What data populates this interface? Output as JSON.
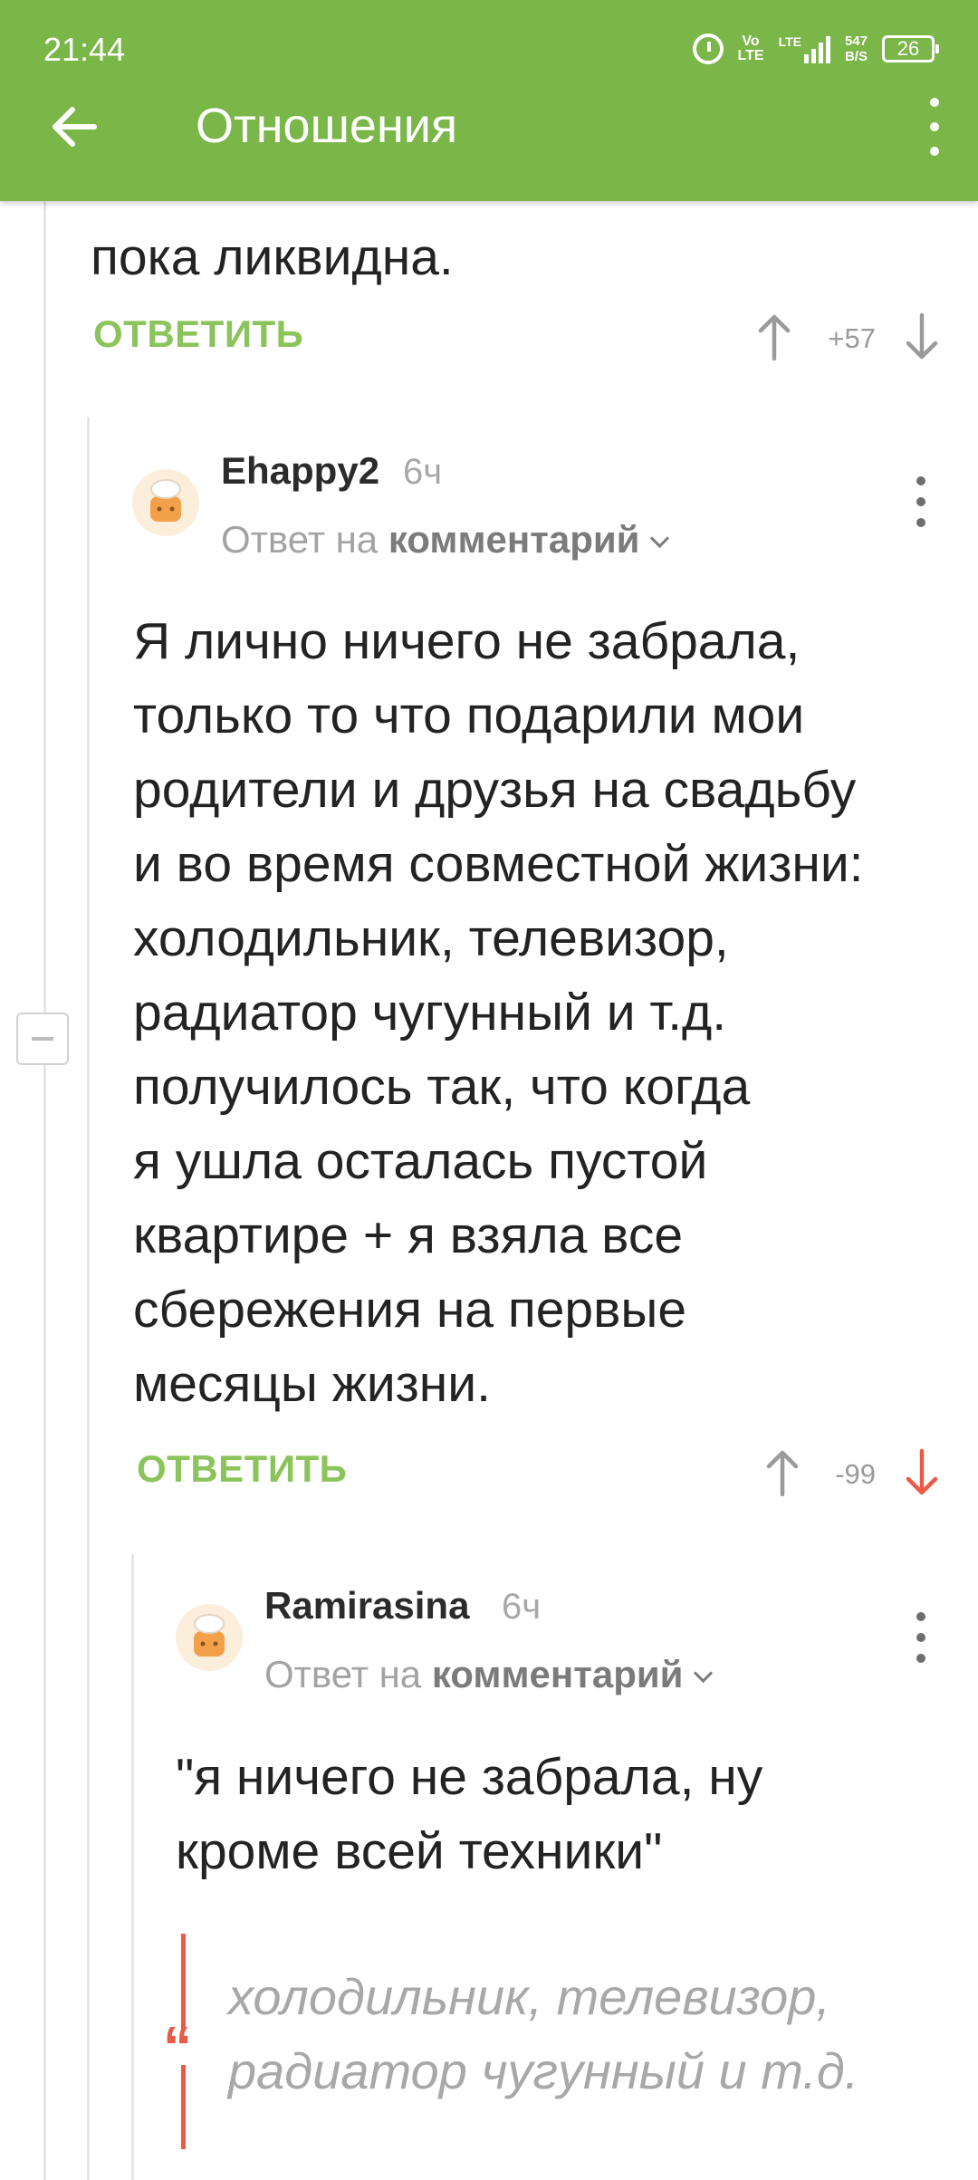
{
  "status_bar": {
    "time": "21:44",
    "volte": "Vo\nLTE",
    "network": "LTE",
    "speed": "547\nB/S",
    "battery": "26"
  },
  "app_bar": {
    "title": "Отношения",
    "back_icon": "arrow-left-icon",
    "menu_icon": "more-vertical-icon"
  },
  "comments": [
    {
      "text_fragment": "пока ликвидна.",
      "reply_label": "ОТВЕТИТЬ",
      "score": "+57"
    },
    {
      "author": "Ehappy2",
      "time": "6ч",
      "reply_prefix": "Ответ на",
      "reply_target": "комментарий",
      "text": "Я лично ничего не забрала,\nтолько то что подарили мои\nродители и друзья на свадьбу\nи во время совместной жизни:\nхолодильник, телевизор,\nрадиатор чугунный и т.д.\nполучилось так, что когда\nя ушла осталась пустой\nквартире + я взяла все\nсбережения на первые\nмесяцы жизни.",
      "reply_label": "ОТВЕТИТЬ",
      "score": "-99"
    },
    {
      "author": "Ramirasina",
      "time": "6ч",
      "reply_prefix": "Ответ на",
      "reply_target": "комментарий",
      "text": "\"я ничего не забрала, ну\nкроме всей техники\"",
      "quote_mark": "“",
      "quote": "холодильник, телевизор,\nрадиатор чугунный и т.д."
    }
  ],
  "colors": {
    "app_bar": "#7ab648",
    "reply_button": "#8cc45c",
    "downvote_active": "#e95b45",
    "quote_bar": "#e95b45"
  }
}
